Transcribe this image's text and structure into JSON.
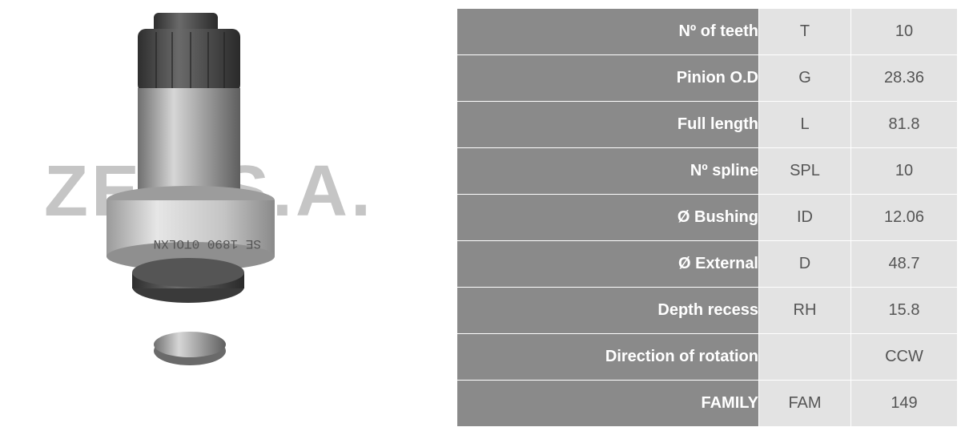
{
  "watermark": "ZEN S.A.",
  "product_image": {
    "engraving": "SE 1890 0TOLXN"
  },
  "specs": [
    {
      "label": "Nº of teeth",
      "code": "T",
      "value": "10"
    },
    {
      "label": "Pinion O.D",
      "code": "G",
      "value": "28.36"
    },
    {
      "label": "Full length",
      "code": "L",
      "value": "81.8"
    },
    {
      "label": "Nº spline",
      "code": "SPL",
      "value": "10"
    },
    {
      "label": "Ø Bushing",
      "code": "ID",
      "value": "12.06"
    },
    {
      "label": "Ø External",
      "code": "D",
      "value": "48.7"
    },
    {
      "label": "Depth recess",
      "code": "RH",
      "value": "15.8"
    },
    {
      "label": "Direction of rotation",
      "code": "",
      "value": "CCW"
    },
    {
      "label": "FAMILY",
      "code": "FAM",
      "value": "149"
    }
  ]
}
